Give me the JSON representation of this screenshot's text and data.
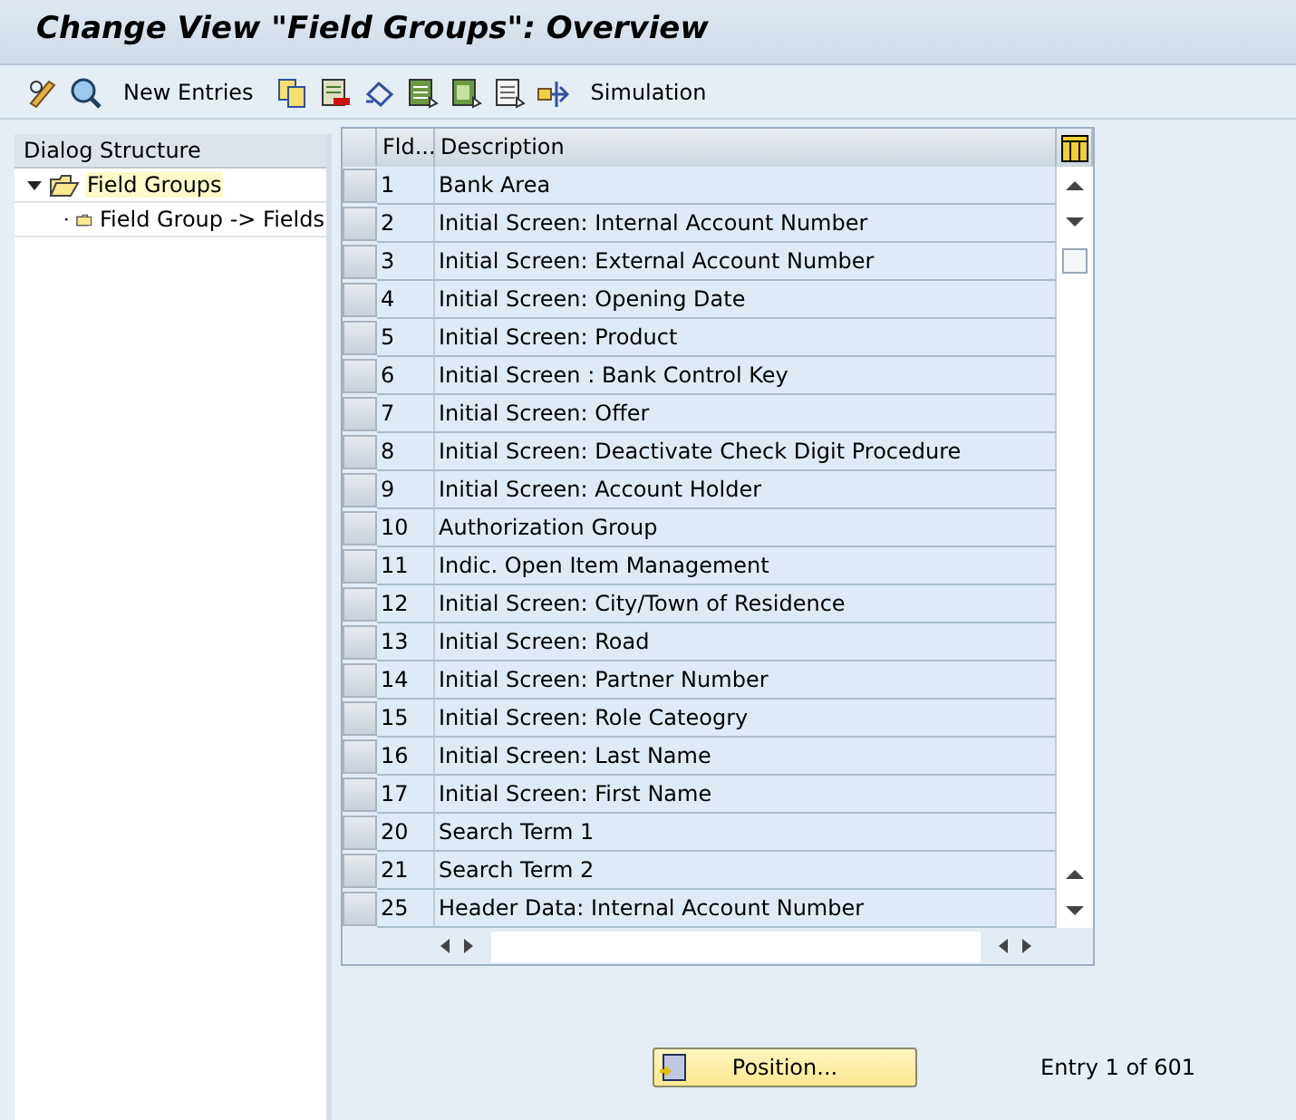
{
  "window": {
    "title": "Change View \"Field Groups\": Overview"
  },
  "toolbar": [
    {
      "kind": "icon"
    },
    {
      "kind": "icon"
    },
    {
      "kind": "text",
      "label": "New Entries"
    },
    {
      "kind": "icon"
    },
    {
      "kind": "icon"
    },
    {
      "kind": "icon"
    },
    {
      "kind": "icon"
    },
    {
      "kind": "icon"
    },
    {
      "kind": "icon"
    },
    {
      "kind": "icon"
    },
    {
      "kind": "text",
      "label": "Simulation"
    }
  ],
  "dialog_structure": {
    "title": "Dialog Structure",
    "items": [
      {
        "label": "Field Groups",
        "expanded": true,
        "selected": true,
        "children": [
          {
            "label": "Field Group -> Fields",
            "selected": false
          }
        ]
      }
    ]
  },
  "table": {
    "columns": [
      "Fld...",
      "Description"
    ],
    "rows": [
      {
        "fld": "1",
        "description": "Bank Area"
      },
      {
        "fld": "2",
        "description": "Initial Screen: Internal Account Number"
      },
      {
        "fld": "3",
        "description": "Initial Screen: External Account Number"
      },
      {
        "fld": "4",
        "description": "Initial Screen: Opening Date"
      },
      {
        "fld": "5",
        "description": "Initial Screen: Product"
      },
      {
        "fld": "6",
        "description": "Initial Screen : Bank Control Key"
      },
      {
        "fld": "7",
        "description": "Initial Screen: Offer"
      },
      {
        "fld": "8",
        "description": "Initial Screen: Deactivate Check Digit Procedure"
      },
      {
        "fld": "9",
        "description": "Initial Screen: Account Holder"
      },
      {
        "fld": "10",
        "description": "Authorization Group"
      },
      {
        "fld": "11",
        "description": "Indic. Open Item Management"
      },
      {
        "fld": "12",
        "description": "Initial Screen: City/Town of Residence"
      },
      {
        "fld": "13",
        "description": "Initial Screen: Road"
      },
      {
        "fld": "14",
        "description": "Initial Screen: Partner Number"
      },
      {
        "fld": "15",
        "description": "Initial Screen: Role Cateogry"
      },
      {
        "fld": "16",
        "description": "Initial Screen: Last Name"
      },
      {
        "fld": "17",
        "description": "Initial Screen: First Name"
      },
      {
        "fld": "20",
        "description": "Search Term 1"
      },
      {
        "fld": "21",
        "description": "Search Term 2"
      },
      {
        "fld": "25",
        "description": "Header Data: Internal Account Number"
      }
    ]
  },
  "footer": {
    "button": "Position...",
    "entry": "Entry 1 of 601"
  }
}
